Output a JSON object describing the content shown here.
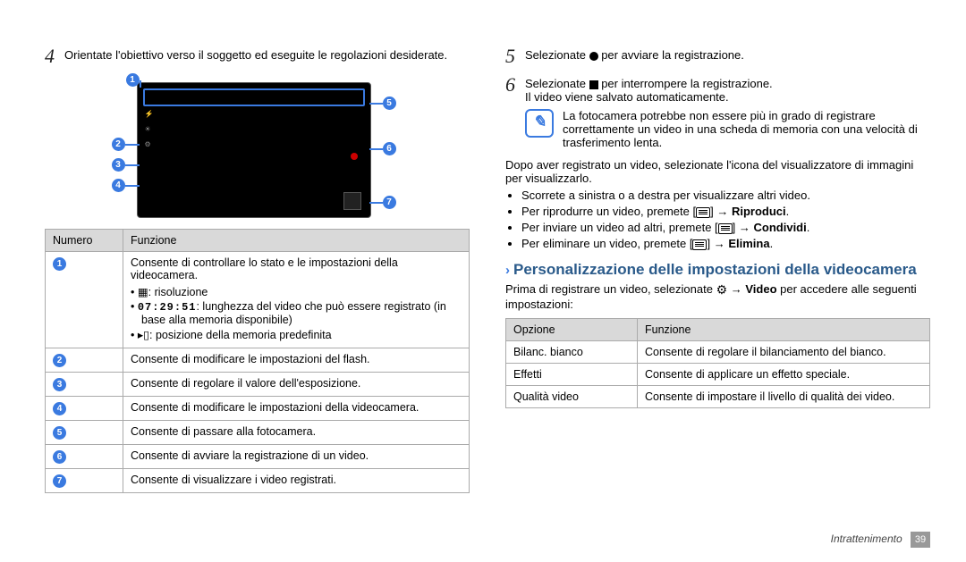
{
  "left": {
    "step4": {
      "num": "4",
      "text": "Orientate l'obiettivo verso il soggetto ed eseguite le regolazioni desiderate."
    },
    "callouts": [
      "1",
      "2",
      "3",
      "4",
      "5",
      "6",
      "7"
    ],
    "table": {
      "headers": [
        "Numero",
        "Funzione"
      ],
      "row1": {
        "mainText": "Consente di controllare lo stato e le impostazioni della videocamera.",
        "b1": {
          "label": ": risoluzione"
        },
        "b2": {
          "code": "07:29:51",
          "rest": ": lunghezza del video che può essere registrato (in base alla memoria disponibile)"
        },
        "b3": {
          "label": ": posizione della memoria predefinita"
        }
      },
      "rows": [
        {
          "n": "2",
          "t": "Consente di modificare le impostazioni del flash."
        },
        {
          "n": "3",
          "t": "Consente di regolare il valore dell'esposizione."
        },
        {
          "n": "4",
          "t": "Consente di modificare le impostazioni della videocamera."
        },
        {
          "n": "5",
          "t": "Consente di passare alla fotocamera."
        },
        {
          "n": "6",
          "t": "Consente di avviare la registrazione di un video."
        },
        {
          "n": "7",
          "t": "Consente di visualizzare i video registrati."
        }
      ]
    }
  },
  "right": {
    "step5": {
      "num": "5",
      "pre": "Selezionate ",
      "post": " per avviare la registrazione."
    },
    "step6": {
      "num": "6",
      "pre": "Selezionate ",
      "post": " per interrompere la registrazione.",
      "line2": "Il video viene salvato automaticamente."
    },
    "note": "La fotocamera potrebbe non essere più in grado di registrare correttamente un video in una scheda di memoria con una velocità di trasferimento lenta.",
    "after": "Dopo aver registrato un video, selezionate l'icona del visualizzatore di immagini per visualizzarlo.",
    "bullets": {
      "b1": "Scorrete a sinistra o a destra per visualizzare altri video.",
      "b2": {
        "pre": "Per riprodurre un video, premete [",
        "post": "] → ",
        "bold": "Riproduci",
        "end": "."
      },
      "b3": {
        "pre": "Per inviare un video ad altri, premete [",
        "post": "] → ",
        "bold": "Condividi",
        "end": "."
      },
      "b4": {
        "pre": "Per eliminare un video, premete [",
        "post": "] → ",
        "bold": "Elimina",
        "end": "."
      }
    },
    "subsection": "Personalizzazione delle impostazioni della videocamera",
    "subIntro": {
      "pre": "Prima di registrare un video, selezionate ",
      "mid": " → ",
      "bold": "Video",
      "post": " per accedere alle seguenti impostazioni:"
    },
    "table2": {
      "headers": [
        "Opzione",
        "Funzione"
      ],
      "rows": [
        {
          "o": "Bilanc. bianco",
          "f": "Consente di regolare il bilanciamento del bianco."
        },
        {
          "o": "Effetti",
          "f": "Consente di applicare un effetto speciale."
        },
        {
          "o": "Qualità video",
          "f": "Consente di impostare il livello di qualità dei video."
        }
      ]
    }
  },
  "footer": {
    "section": "Intrattenimento",
    "page": "39"
  }
}
